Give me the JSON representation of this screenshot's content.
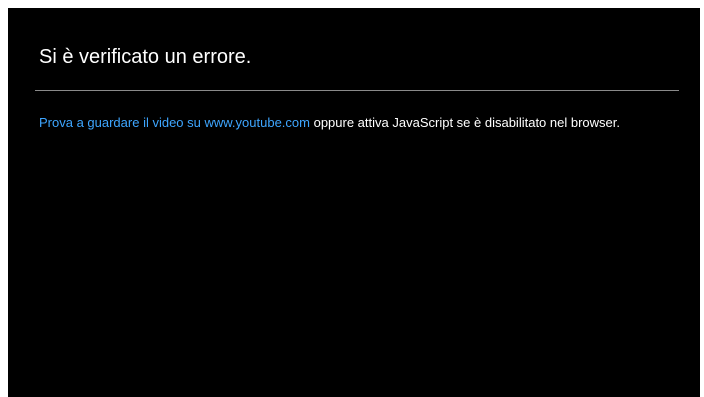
{
  "error": {
    "title": "Si è verificato un errore.",
    "link_text": "Prova a guardare il video su www.youtube.com",
    "message_rest": " oppure attiva JavaScript se è disabilitato nel browser."
  },
  "colors": {
    "background": "#000000",
    "text": "#ffffff",
    "link": "#3ea6ff",
    "divider": "#8a8a8a"
  }
}
